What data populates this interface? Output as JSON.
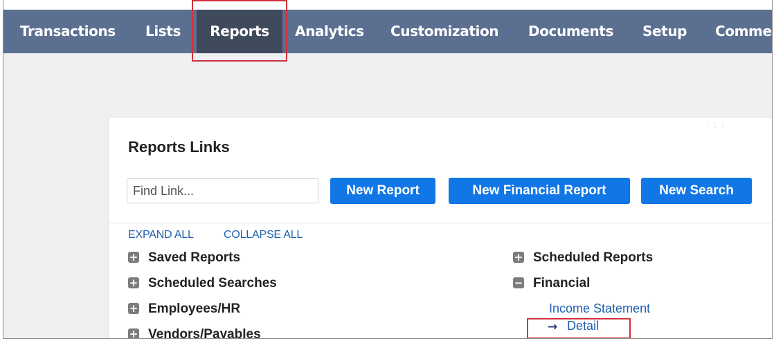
{
  "nav": {
    "items": [
      {
        "label": "Transactions"
      },
      {
        "label": "Lists"
      },
      {
        "label": "Reports",
        "active": true
      },
      {
        "label": "Analytics"
      },
      {
        "label": "Customization"
      },
      {
        "label": "Documents"
      },
      {
        "label": "Setup"
      },
      {
        "label": "Comme"
      }
    ]
  },
  "portlet": {
    "title": "Reports Links",
    "search_placeholder": "Find Link...",
    "buttons": {
      "new_report": "New Report",
      "new_financial_report": "New Financial Report",
      "new_search": "New Search"
    },
    "expand_all": "EXPAND ALL",
    "collapse_all": "COLLAPSE ALL",
    "left_sections": [
      {
        "label": "Saved Reports",
        "state": "+"
      },
      {
        "label": "Scheduled Searches",
        "state": "+"
      },
      {
        "label": "Employees/HR",
        "state": "+"
      },
      {
        "label": "Vendors/Payables",
        "state": "+"
      }
    ],
    "right_sections": [
      {
        "label": "Scheduled Reports",
        "state": "+"
      },
      {
        "label": "Financial",
        "state": "−"
      }
    ],
    "financial_links": {
      "income_statement": "Income Statement",
      "detail_arrow": "→",
      "detail": "Detail"
    }
  },
  "colors": {
    "nav_bg": "#5b6f91",
    "nav_active_bg": "#3f4a5c",
    "button_blue": "#1277e6",
    "link_blue": "#1f5fb0",
    "highlight_red": "#d1313b",
    "page_bg": "#eef0f2"
  },
  "icons": {
    "expand": "plus-square-icon",
    "collapse": "minus-square-icon",
    "drag": "drag-handle-icon",
    "arrow": "right-arrow-icon"
  }
}
